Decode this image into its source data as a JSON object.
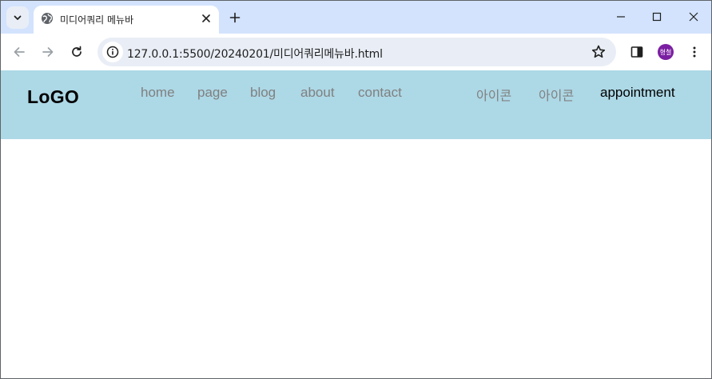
{
  "browser": {
    "tab": {
      "title": "미디어쿼리 메뉴바"
    },
    "address_bar": {
      "url": "127.0.0.1:5500/20240201/미디어쿼리메뉴바.html"
    },
    "profile": {
      "initials": "형철",
      "color": "#7b1fa2"
    }
  },
  "page": {
    "navbar": {
      "background": "#add8e6",
      "logo": "LoGO",
      "links": [
        {
          "label": "home"
        },
        {
          "label": "page"
        },
        {
          "label": "blog"
        },
        {
          "label": "about"
        },
        {
          "label": "contact"
        }
      ],
      "icons": [
        {
          "label": "아이콘"
        },
        {
          "label": "아이콘"
        }
      ],
      "cta": "appointment"
    }
  }
}
